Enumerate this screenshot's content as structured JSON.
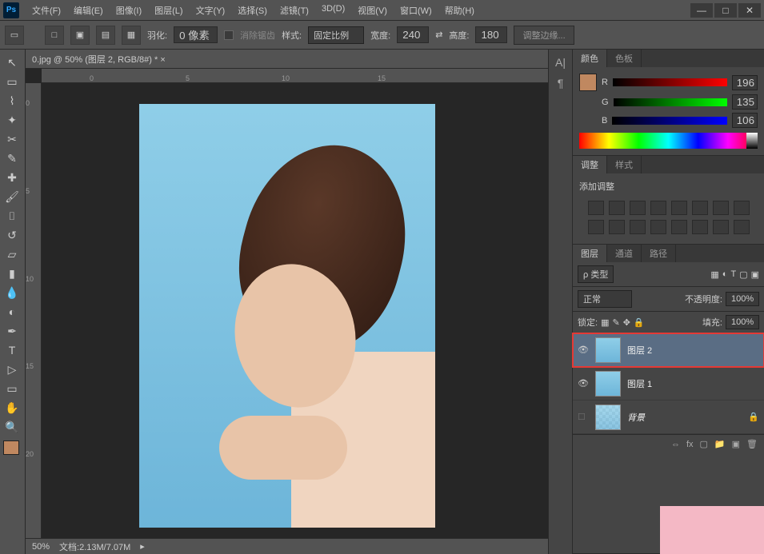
{
  "menu": [
    "文件(F)",
    "编辑(E)",
    "图像(I)",
    "图层(L)",
    "文字(Y)",
    "选择(S)",
    "滤镜(T)",
    "3D(D)",
    "视图(V)",
    "窗口(W)",
    "帮助(H)"
  ],
  "options": {
    "feather_label": "羽化:",
    "feather_value": "0 像素",
    "antialias": "消除锯齿",
    "style_label": "样式:",
    "style_value": "固定比例",
    "width_label": "宽度:",
    "width_value": "240",
    "height_label": "高度:",
    "height_value": "180",
    "refine_edge": "调整边缘..."
  },
  "doc_tab": "0.jpg @ 50% (图层 2, RGB/8#) * ×",
  "ruler_h": [
    "0",
    "5",
    "10",
    "15"
  ],
  "ruler_v": [
    "0",
    "5",
    "10",
    "15",
    "20"
  ],
  "status": {
    "zoom": "50%",
    "doc": "文档:2.13M/7.07M"
  },
  "color": {
    "tab_color": "颜色",
    "tab_swatch": "色板",
    "r": "196",
    "g": "135",
    "b": "106"
  },
  "adjust": {
    "tab_adjust": "调整",
    "tab_style": "样式",
    "title": "添加调整"
  },
  "layers": {
    "tab_layers": "图层",
    "tab_channels": "通道",
    "tab_paths": "路径",
    "kind": "ρ 类型",
    "blend": "正常",
    "opacity_label": "不透明度:",
    "opacity_value": "100%",
    "lock_label": "锁定:",
    "fill_label": "填充:",
    "fill_value": "100%",
    "layer2": "图层 2",
    "layer1": "图层 1",
    "bg": "背景"
  }
}
